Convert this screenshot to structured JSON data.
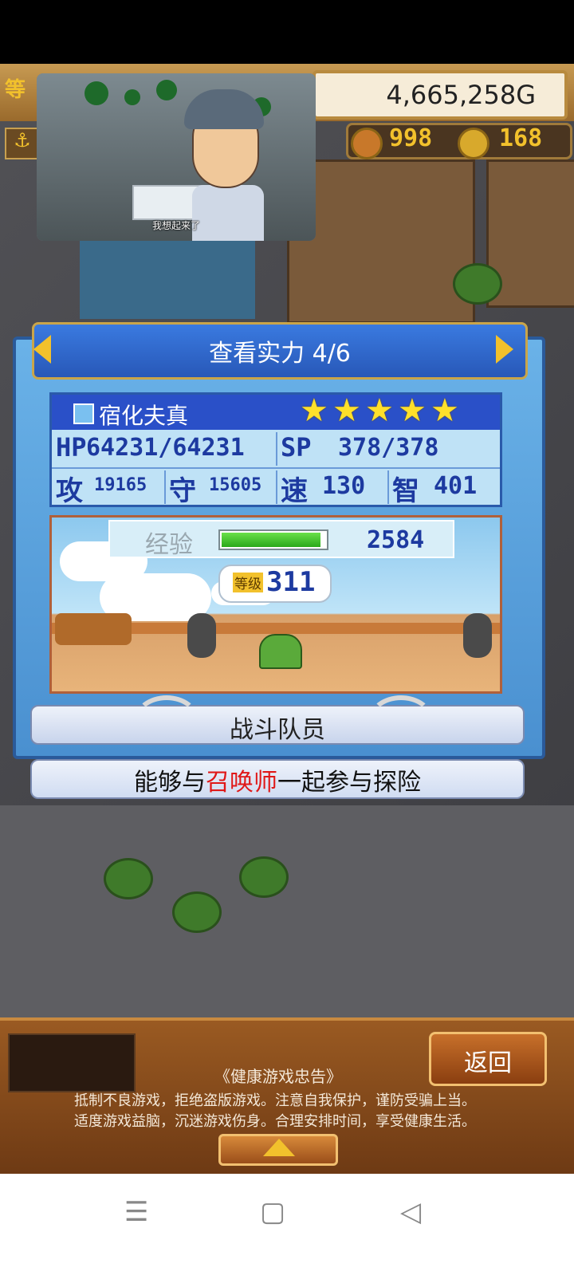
{
  "header": {
    "gold": "4,665,258G",
    "resource1": "998",
    "resource2": "168",
    "corner_label": "等"
  },
  "video": {
    "subtitle": "我想起来了"
  },
  "panel": {
    "title": "查看实力 4/6",
    "character_name": "宿化夫真",
    "stars": 5,
    "hp_label": "HP",
    "hp_value": "64231/64231",
    "sp_label": "SP",
    "sp_value": "378/378",
    "atk_label": "攻",
    "atk_value": "19165",
    "def_label": "守",
    "def_value": "15605",
    "spd_label": "速",
    "spd_value": "130",
    "int_label": "智",
    "int_value": "401",
    "exp_label": "经验",
    "exp_value": "2584",
    "exp_fill_fraction": 0.95,
    "level_label": "等级",
    "level_value": "311",
    "role": "战斗队员",
    "desc_before": "能够与",
    "desc_highlight": "召唤师",
    "desc_after": "一起参与探险"
  },
  "bottom": {
    "back_label": "返回",
    "warning_title": "《健康游戏忠告》",
    "warning_line1": "抵制不良游戏，拒绝盗版游戏。注意自我保护，谨防受骗上当。",
    "warning_line2": "适度游戏益脑，沉迷游戏伤身。合理安排时间，享受健康生活。"
  },
  "nav": {
    "menu_icon": "menu-icon",
    "home_icon": "home-icon",
    "back_icon": "back-icon"
  },
  "colors": {
    "panel_blue": "#4a90d0",
    "title_blue": "#2858b8",
    "gold": "#f2c12c",
    "highlight_red": "#e01818",
    "wood": "#9a5a22"
  }
}
